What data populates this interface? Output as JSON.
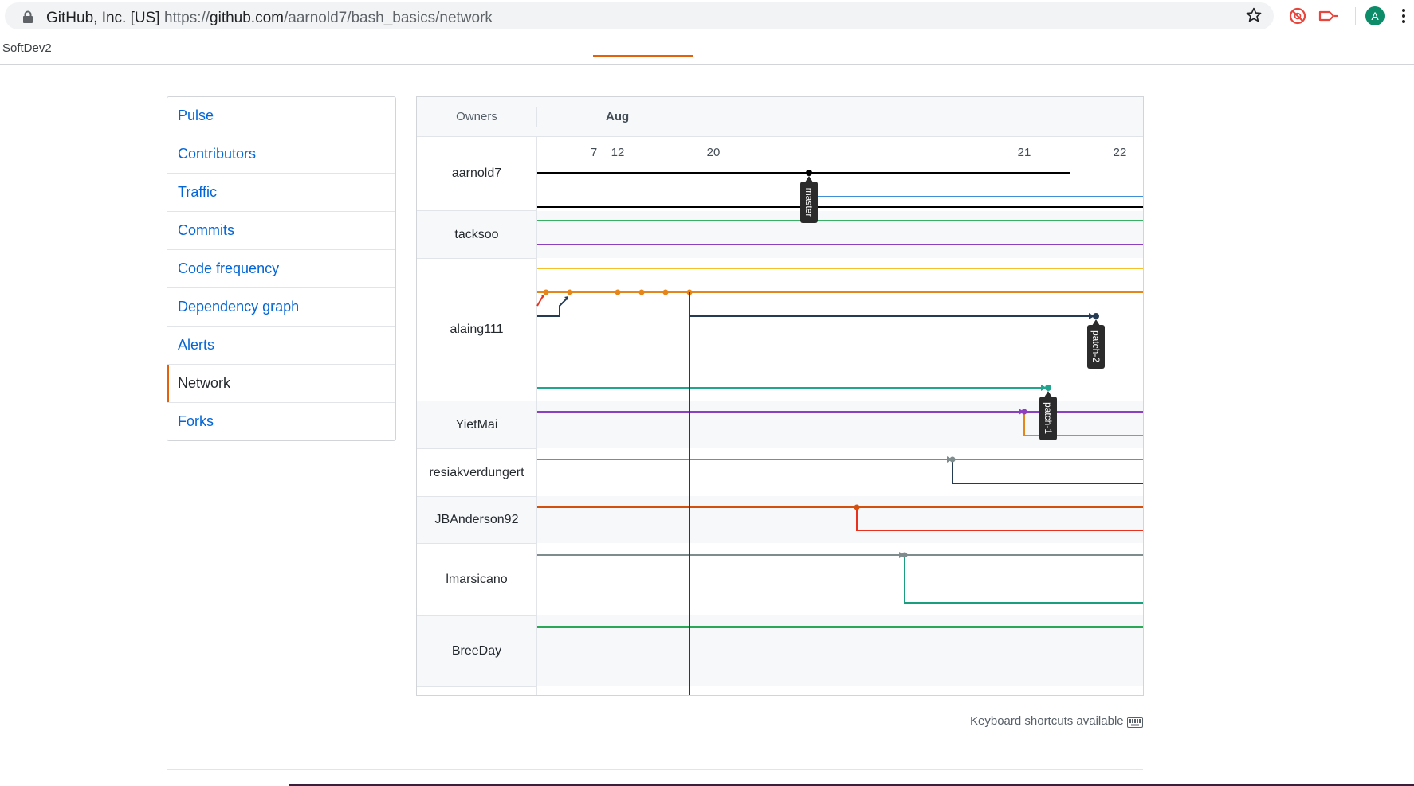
{
  "browser": {
    "site_identity": "GitHub, Inc. [US]",
    "url_prefix": "https://",
    "url_host": "github.com",
    "url_path": "/aarnold7/bash_basics/network",
    "avatar_letter": "A",
    "bookmark": "SoftDev2"
  },
  "sidebar": {
    "items": [
      {
        "label": "Pulse"
      },
      {
        "label": "Contributors"
      },
      {
        "label": "Traffic"
      },
      {
        "label": "Commits"
      },
      {
        "label": "Code frequency"
      },
      {
        "label": "Dependency graph"
      },
      {
        "label": "Alerts"
      },
      {
        "label": "Network",
        "selected": true
      },
      {
        "label": "Forks"
      }
    ]
  },
  "network": {
    "owners_header": "Owners",
    "month": "Aug",
    "days": [
      "7",
      "12",
      "20",
      "21",
      "22"
    ],
    "owners": [
      "aarnold7",
      "tacksoo",
      "alaing111",
      "YietMai",
      "resiakverdungert",
      "JBAnderson92",
      "lmarsicano",
      "BreeDay"
    ],
    "branch_labels": {
      "master": "master",
      "patch2": "patch-2",
      "patch1": "patch-1"
    },
    "colors": {
      "black": "#000000",
      "blue": "#3f8ed6",
      "green": "#38b063",
      "purple": "#8c3fbf",
      "yellow": "#f4c02b",
      "orange": "#e5861b",
      "navy": "#243b53",
      "teal": "#21a58f",
      "gray": "#7f8c8d",
      "dark_orange": "#d4500f",
      "red": "#e8321e",
      "dark_teal": "#1b9e7d",
      "sea_green": "#2aa757",
      "tag_bg": "#2b2b2b"
    }
  },
  "footer": {
    "shortcuts_text": "Keyboard shortcuts available"
  }
}
